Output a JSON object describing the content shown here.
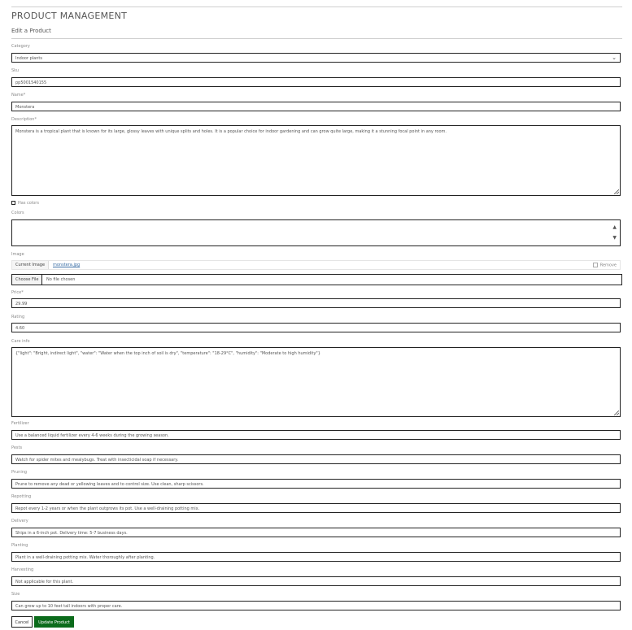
{
  "header": {
    "title": "PRODUCT MANAGEMENT",
    "subtitle": "Edit a Product"
  },
  "form": {
    "category": {
      "label": "Category",
      "value": "Indoor plants"
    },
    "sku": {
      "label": "Sku",
      "value": "pp5001540155"
    },
    "name": {
      "label": "Name*",
      "value": "Monstera"
    },
    "description": {
      "label": "Description*",
      "value": "Monstera is a tropical plant that is known for its large, glossy leaves with unique splits and holes. It is a popular choice for indoor gardening and can grow quite large, making it a stunning focal point in any room."
    },
    "has_colors": {
      "label": "Has colors"
    },
    "colors": {
      "label": "Colors"
    },
    "image": {
      "label": "Image",
      "current_label": "Current Image",
      "filename_link": "monstera.jpg",
      "remove_label": "Remove",
      "choose_button": "Choose File",
      "no_file": "No file chosen"
    },
    "price": {
      "label": "Price*",
      "value": "29.99"
    },
    "rating": {
      "label": "Rating",
      "value": "4.60"
    },
    "care_info": {
      "label": "Care info",
      "value": "{\"light\": \"Bright, indirect light\", \"water\": \"Water when the top inch of soil is dry\", \"temperature\": \"18-29°C\", \"humidity\": \"Moderate to high humidity\"}"
    },
    "fertilizer": {
      "label": "Fertilizer",
      "value": "Use a balanced liquid fertilizer every 4-6 weeks during the growing season."
    },
    "pests": {
      "label": "Pests",
      "value": "Watch for spider mites and mealybugs. Treat with insecticidal soap if necessary."
    },
    "pruning": {
      "label": "Pruning",
      "value": "Prune to remove any dead or yellowing leaves and to control size. Use clean, sharp scissors."
    },
    "repotting": {
      "label": "Repotting",
      "value": "Repot every 1-2 years or when the plant outgrows its pot. Use a well-draining potting mix."
    },
    "delivery": {
      "label": "Delivery",
      "value": "Ships in a 6-inch pot. Delivery time: 5-7 business days."
    },
    "planting": {
      "label": "Planting",
      "value": "Plant in a well-draining potting mix. Water thoroughly after planting."
    },
    "harvesting": {
      "label": "Harvesting",
      "value": "Not applicable for this plant."
    },
    "size": {
      "label": "Size",
      "value": "Can grow up to 10 feet tall indoors with proper care."
    }
  },
  "actions": {
    "cancel_label": "Cancel",
    "update_label": "Update Product"
  },
  "colors": {
    "primary_button": "#0b6b1b",
    "link": "#3a6ea5"
  }
}
